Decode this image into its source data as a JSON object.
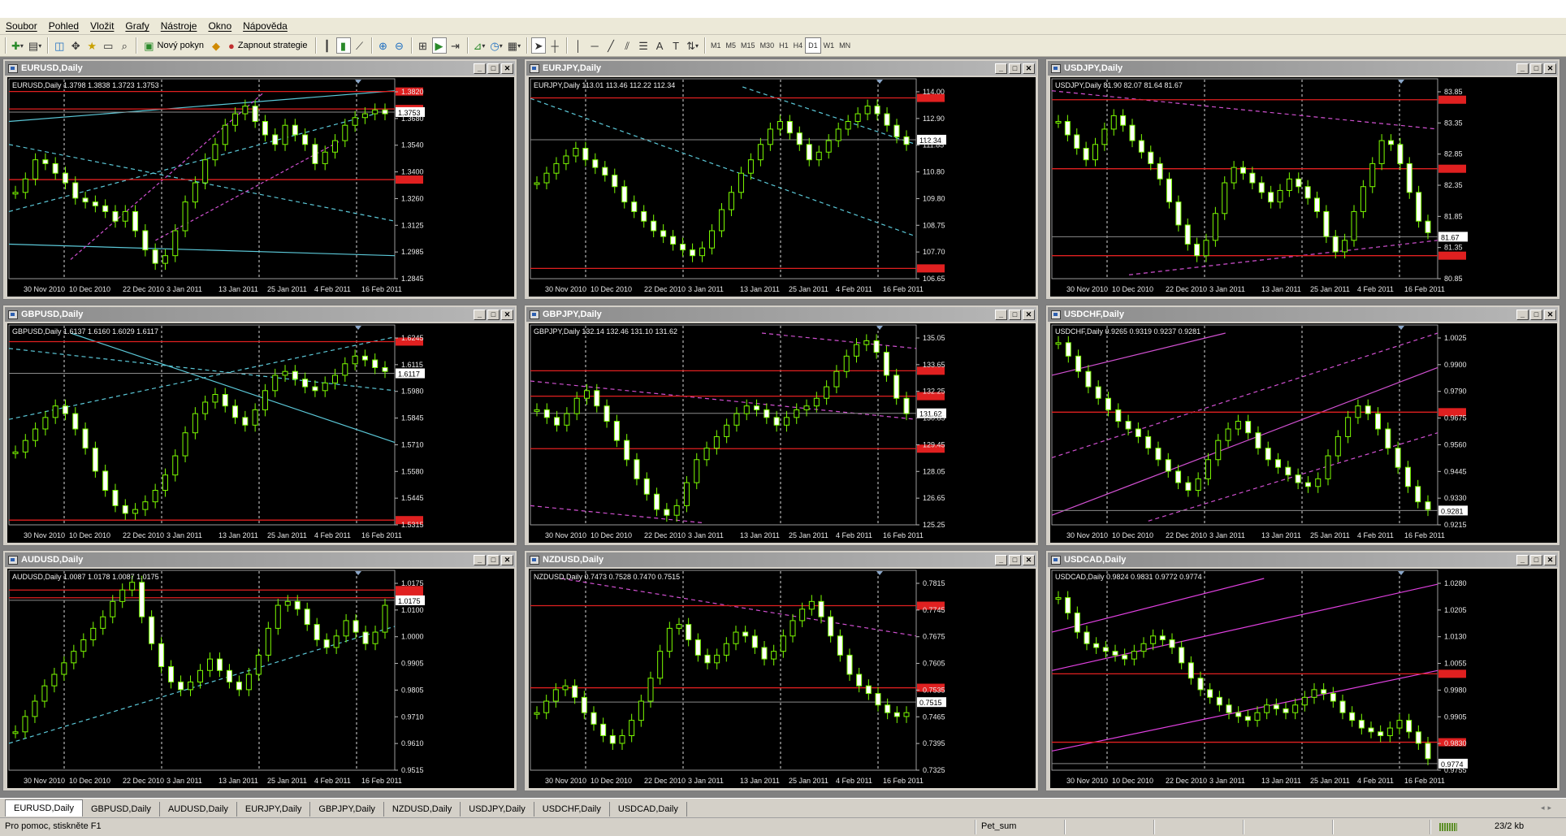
{
  "menu": [
    "Soubor",
    "Pohled",
    "Vložit",
    "Grafy",
    "Nástroje",
    "Okno",
    "Nápověda"
  ],
  "toolbar": {
    "new_order": "Nový pokyn",
    "expert": "Zapnout strategie",
    "timeframes": [
      "M1",
      "M5",
      "M15",
      "M30",
      "H1",
      "H4",
      "D1",
      "W1",
      "MN"
    ],
    "active_timeframe": "D1"
  },
  "x_labels": [
    "30 Nov 2010",
    "10 Dec 2010",
    "22 Dec 2010",
    "3 Jan 2011",
    "13 Jan 2011",
    "25 Jan 2011",
    "4 Feb 2011",
    "16 Feb 2011"
  ],
  "charts": [
    {
      "title": "EURUSD,Daily",
      "info": "EURUSD,Daily  1.3798 1.3838 1.3723 1.3753",
      "ticks": [
        "1.3820",
        "1.3680",
        "1.3540",
        "1.3400",
        "1.3260",
        "1.3125",
        "1.2985",
        "1.2845"
      ],
      "ymin": 1.2845,
      "ymax": 1.389,
      "price": 1.3753,
      "levels": [
        1.3865,
        1.377,
        1.3385
      ],
      "lines": [
        {
          "c": "#5bc8d8",
          "d": "1",
          "p": [
            0,
            0.18,
            1,
            0.12
          ]
        },
        {
          "c": "#5bc8d8",
          "d": "1",
          "p": [
            0,
            0.82,
            1,
            0.98
          ]
        },
        {
          "c": "#5bc8d8",
          "d": "5,4",
          "p": [
            0,
            0.7,
            1,
            0.3
          ]
        },
        {
          "c": "#5bc8d8",
          "d": "5,4",
          "p": [
            0,
            0.35,
            0.95,
            0.86
          ]
        },
        {
          "c": "#d050d0",
          "d": "4,3",
          "p": [
            0.16,
            0.1,
            0.66,
            0.97
          ]
        },
        {
          "c": "#d050d0",
          "d": "4,3",
          "p": [
            0.38,
            0.2,
            0.86,
            0.72
          ]
        }
      ],
      "path": [
        0.45,
        0.52,
        0.62,
        0.6,
        0.55,
        0.5,
        0.42,
        0.4,
        0.38,
        0.35,
        0.3,
        0.35,
        0.25,
        0.15,
        0.08,
        0.12,
        0.25,
        0.4,
        0.5,
        0.62,
        0.7,
        0.8,
        0.86,
        0.9,
        0.82,
        0.75,
        0.7,
        0.8,
        0.75,
        0.7,
        0.6,
        0.66,
        0.72,
        0.8,
        0.84,
        0.86,
        0.88,
        0.86
      ]
    },
    {
      "title": "EURJPY,Daily",
      "info": "EURJPY,Daily  113.01 113.46 112.22 112.34",
      "ticks": [
        "114.00",
        "112.90",
        "111.85",
        "110.80",
        "109.80",
        "108.75",
        "107.70",
        "106.65"
      ],
      "ymin": 106.65,
      "ymax": 114.5,
      "price": 112.34,
      "levels": [
        114.05,
        107.07
      ],
      "lines": [
        {
          "c": "#5bc8d8",
          "d": "5,4",
          "p": [
            0,
            0.94,
            1,
            0.22
          ]
        },
        {
          "c": "#5bc8d8",
          "d": "5,4",
          "p": [
            0.55,
            1.0,
            1,
            0.7
          ]
        }
      ],
      "path": [
        0.5,
        0.55,
        0.6,
        0.64,
        0.68,
        0.62,
        0.58,
        0.54,
        0.48,
        0.4,
        0.35,
        0.3,
        0.25,
        0.22,
        0.18,
        0.15,
        0.12,
        0.16,
        0.25,
        0.36,
        0.45,
        0.55,
        0.62,
        0.7,
        0.78,
        0.82,
        0.76,
        0.7,
        0.62,
        0.66,
        0.72,
        0.78,
        0.82,
        0.86,
        0.9,
        0.86,
        0.8,
        0.74,
        0.7
      ]
    },
    {
      "title": "USDJPY,Daily",
      "info": "USDJPY,Daily  81.90 82.07 81.64 81.67",
      "ticks": [
        "83.85",
        "83.35",
        "82.85",
        "82.35",
        "81.85",
        "81.35",
        "80.85"
      ],
      "ymin": 80.85,
      "ymax": 84.6,
      "price": 81.67,
      "levels": [
        84.35,
        83.0,
        81.3
      ],
      "lines": [
        {
          "c": "#d050d0",
          "d": "5,4",
          "p": [
            0,
            0.98,
            1,
            0.78
          ]
        },
        {
          "c": "#d050d0",
          "d": "5,4",
          "p": [
            0.2,
            0.02,
            1,
            0.2
          ]
        }
      ],
      "path": [
        0.82,
        0.75,
        0.68,
        0.62,
        0.7,
        0.78,
        0.85,
        0.8,
        0.72,
        0.66,
        0.6,
        0.52,
        0.4,
        0.28,
        0.18,
        0.12,
        0.2,
        0.34,
        0.5,
        0.58,
        0.55,
        0.5,
        0.45,
        0.4,
        0.46,
        0.52,
        0.48,
        0.42,
        0.35,
        0.22,
        0.14,
        0.2,
        0.35,
        0.48,
        0.6,
        0.72,
        0.7,
        0.6,
        0.45,
        0.3,
        0.24
      ]
    },
    {
      "title": "GBPUSD,Daily",
      "info": "GBPUSD,Daily  1.6137 1.6160 1.6029 1.6117",
      "ticks": [
        "1.6245",
        "1.6115",
        "1.5980",
        "1.5845",
        "1.5710",
        "1.5580",
        "1.5445",
        "1.5315"
      ],
      "ymin": 1.5315,
      "ymax": 1.633,
      "price": 1.6117,
      "levels": [
        1.6285,
        1.534
      ],
      "lines": [
        {
          "c": "#5bc8d8",
          "d": "1",
          "p": [
            0.16,
            1.0,
            1,
            0.43
          ]
        },
        {
          "c": "#5bc8d8",
          "d": "5,4",
          "p": [
            0,
            0.55,
            1,
            0.98
          ]
        },
        {
          "c": "#5bc8d8",
          "d": "5,4",
          "p": [
            0,
            0.92,
            1,
            0.7
          ]
        }
      ],
      "path": [
        0.38,
        0.44,
        0.5,
        0.56,
        0.62,
        0.58,
        0.5,
        0.4,
        0.28,
        0.18,
        0.1,
        0.06,
        0.08,
        0.12,
        0.18,
        0.26,
        0.36,
        0.48,
        0.58,
        0.64,
        0.68,
        0.62,
        0.56,
        0.52,
        0.6,
        0.7,
        0.78,
        0.8,
        0.76,
        0.72,
        0.7,
        0.74,
        0.78,
        0.84,
        0.88,
        0.86,
        0.82,
        0.8
      ]
    },
    {
      "title": "GBPJPY,Daily",
      "info": "GBPJPY,Daily  132.14 132.46 131.10 131.62",
      "ticks": [
        "135.05",
        "133.65",
        "132.25",
        "130.85",
        "129.45",
        "128.05",
        "126.65",
        "125.25"
      ],
      "ymin": 125.25,
      "ymax": 136.2,
      "price": 131.62,
      "levels": [
        134.05,
        132.6,
        129.6
      ],
      "lines": [
        {
          "c": "#d050d0",
          "d": "5,4",
          "p": [
            0,
            0.75,
            1,
            0.55
          ]
        },
        {
          "c": "#d050d0",
          "d": "5,4",
          "p": [
            0,
            0.1,
            0.45,
            0.01
          ]
        },
        {
          "c": "#d050d0",
          "d": "5,4",
          "p": [
            0.6,
            1.0,
            1,
            0.92
          ]
        }
      ],
      "path": [
        0.6,
        0.56,
        0.52,
        0.58,
        0.66,
        0.7,
        0.62,
        0.54,
        0.44,
        0.34,
        0.24,
        0.16,
        0.08,
        0.05,
        0.1,
        0.22,
        0.34,
        0.4,
        0.46,
        0.52,
        0.58,
        0.62,
        0.6,
        0.56,
        0.52,
        0.56,
        0.6,
        0.62,
        0.66,
        0.72,
        0.8,
        0.88,
        0.94,
        0.96,
        0.9,
        0.78,
        0.66,
        0.58
      ]
    },
    {
      "title": "USDCHF,Daily",
      "info": "USDCHF,Daily  0.9265 0.9319 0.9237 0.9281",
      "ticks": [
        "1.0025",
        "0.9900",
        "0.9790",
        "0.9675",
        "0.9560",
        "0.9445",
        "0.9330",
        "0.9215"
      ],
      "ymin": 0.9215,
      "ymax": 1.01,
      "price": 0.9281,
      "levels": [
        0.9735
      ],
      "lines": [
        {
          "c": "#d050d0",
          "d": "1",
          "p": [
            0,
            0.05,
            1,
            0.82
          ]
        },
        {
          "c": "#d050d0",
          "d": "5,4",
          "p": [
            0,
            0.35,
            1,
            1.0
          ]
        },
        {
          "c": "#d050d0",
          "d": "5,4",
          "p": [
            0.25,
            0.02,
            1,
            0.48
          ]
        },
        {
          "c": "#d050d0",
          "d": "1",
          "p": [
            0,
            0.78,
            0.45,
            1.0
          ]
        }
      ],
      "path": [
        0.95,
        0.88,
        0.8,
        0.72,
        0.66,
        0.6,
        0.54,
        0.5,
        0.46,
        0.4,
        0.34,
        0.28,
        0.22,
        0.18,
        0.24,
        0.34,
        0.44,
        0.5,
        0.54,
        0.48,
        0.4,
        0.34,
        0.3,
        0.26,
        0.22,
        0.2,
        0.24,
        0.36,
        0.46,
        0.56,
        0.62,
        0.58,
        0.5,
        0.4,
        0.3,
        0.2,
        0.12,
        0.08
      ]
    },
    {
      "title": "AUDUSD,Daily",
      "info": "AUDUSD,Daily  1.0087 1.0178 1.0087 1.0175",
      "ticks": [
        "1.0175",
        "1.0100",
        "1.0000",
        "0.9905",
        "0.9805",
        "0.9710",
        "0.9610",
        "0.9515"
      ],
      "ymin": 0.9515,
      "ymax": 1.026,
      "price": 1.0175,
      "levels": [
        1.0215,
        1.0185
      ],
      "lines": [
        {
          "c": "#5bc8d8",
          "d": "5,4",
          "p": [
            0,
            0.14,
            1,
            0.75
          ]
        }
      ],
      "path": [
        0.2,
        0.28,
        0.36,
        0.44,
        0.5,
        0.56,
        0.62,
        0.68,
        0.74,
        0.8,
        0.88,
        0.94,
        0.98,
        0.8,
        0.66,
        0.54,
        0.46,
        0.42,
        0.46,
        0.52,
        0.58,
        0.52,
        0.46,
        0.42,
        0.5,
        0.6,
        0.74,
        0.86,
        0.88,
        0.84,
        0.76,
        0.68,
        0.64,
        0.7,
        0.78,
        0.72,
        0.66,
        0.72,
        0.86
      ]
    },
    {
      "title": "NZDUSD,Daily",
      "info": "NZDUSD,Daily  0.7473 0.7528 0.7470 0.7515",
      "ticks": [
        "0.7815",
        "0.7745",
        "0.7675",
        "0.7605",
        "0.7535",
        "0.7465",
        "0.7395",
        "0.7325"
      ],
      "ymin": 0.7325,
      "ymax": 0.786,
      "price": 0.7515,
      "levels": [
        0.7784,
        0.7555
      ],
      "lines": [
        {
          "c": "#d050d0",
          "d": "5,4",
          "p": [
            0.08,
            1.0,
            1,
            0.7
          ]
        }
      ],
      "path": [
        0.3,
        0.36,
        0.42,
        0.44,
        0.38,
        0.3,
        0.24,
        0.18,
        0.14,
        0.18,
        0.26,
        0.36,
        0.48,
        0.62,
        0.74,
        0.76,
        0.68,
        0.6,
        0.56,
        0.6,
        0.66,
        0.72,
        0.7,
        0.64,
        0.58,
        0.62,
        0.7,
        0.78,
        0.84,
        0.88,
        0.8,
        0.7,
        0.6,
        0.5,
        0.44,
        0.4,
        0.34,
        0.3,
        0.28,
        0.3
      ]
    },
    {
      "title": "USDCAD,Daily",
      "info": "USDCAD,Daily  0.9824 0.9831 0.9772 0.9774",
      "ticks": [
        "1.0280",
        "1.0205",
        "1.0130",
        "1.0055",
        "0.9980",
        "0.9905",
        "0.9830",
        "0.9755"
      ],
      "ymin": 0.9755,
      "ymax": 1.031,
      "price": 0.9774,
      "levels": [
        1.0034,
        0.9836
      ],
      "lines": [
        {
          "c": "#e040e0",
          "d": "1",
          "p": [
            0,
            0.1,
            1,
            0.52
          ]
        },
        {
          "c": "#e040e0",
          "d": "1",
          "p": [
            0,
            0.52,
            1,
            0.97
          ]
        },
        {
          "c": "#e040e0",
          "d": "1",
          "p": [
            0,
            0.72,
            0.55,
            1.0
          ]
        }
      ],
      "path": [
        0.9,
        0.82,
        0.72,
        0.66,
        0.64,
        0.62,
        0.6,
        0.58,
        0.62,
        0.66,
        0.7,
        0.68,
        0.64,
        0.56,
        0.48,
        0.42,
        0.38,
        0.34,
        0.3,
        0.28,
        0.26,
        0.3,
        0.34,
        0.32,
        0.3,
        0.34,
        0.38,
        0.42,
        0.4,
        0.36,
        0.3,
        0.26,
        0.22,
        0.2,
        0.18,
        0.22,
        0.26,
        0.2,
        0.14,
        0.06
      ]
    }
  ],
  "tabs": [
    "EURUSD,Daily",
    "GBPUSD,Daily",
    "AUDUSD,Daily",
    "EURJPY,Daily",
    "GBPJPY,Daily",
    "NZDUSD,Daily",
    "USDJPY,Daily",
    "USDCHF,Daily",
    "USDCAD,Daily"
  ],
  "active_tab": 0,
  "status": {
    "help": "Pro pomoc, stiskněte F1",
    "profile": "Pet_sum",
    "traffic": "23/2 kb"
  }
}
